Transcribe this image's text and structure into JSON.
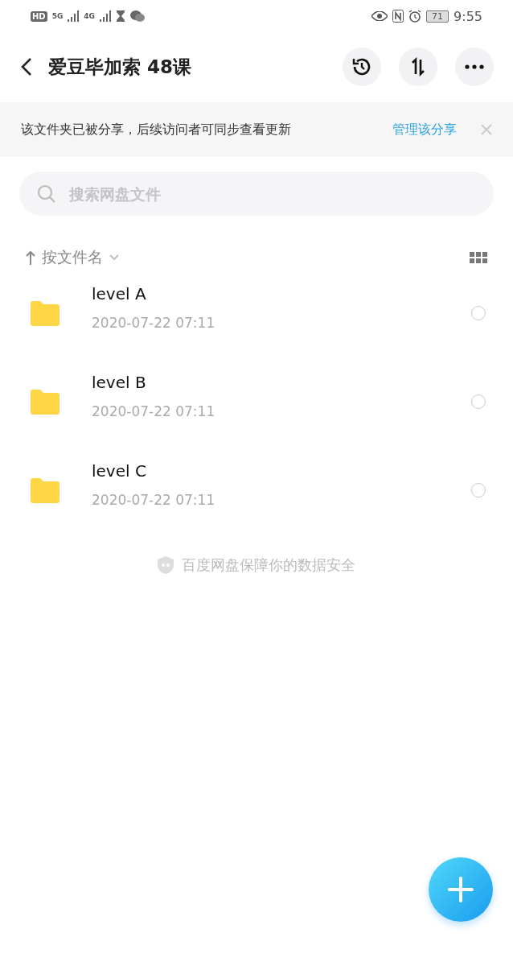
{
  "status_bar": {
    "left_labels": [
      "HD",
      "5G",
      "4G"
    ],
    "battery": "71",
    "time": "9:55"
  },
  "header": {
    "title": "爱豆毕加索 48课"
  },
  "share_banner": {
    "text": "该文件夹已被分享，后续访问者可同步查看更新",
    "action": "管理该分享"
  },
  "search": {
    "placeholder": "搜索网盘文件"
  },
  "sort": {
    "label": "按文件名"
  },
  "files": [
    {
      "name": "level A",
      "date": "2020-07-22  07:11",
      "selected": false
    },
    {
      "name": "level B",
      "date": "2020-07-22  07:11",
      "selected": false
    },
    {
      "name": "level C",
      "date": "2020-07-22  07:11",
      "selected": false
    }
  ],
  "footer_note": "百度网盘保障你的数据安全"
}
